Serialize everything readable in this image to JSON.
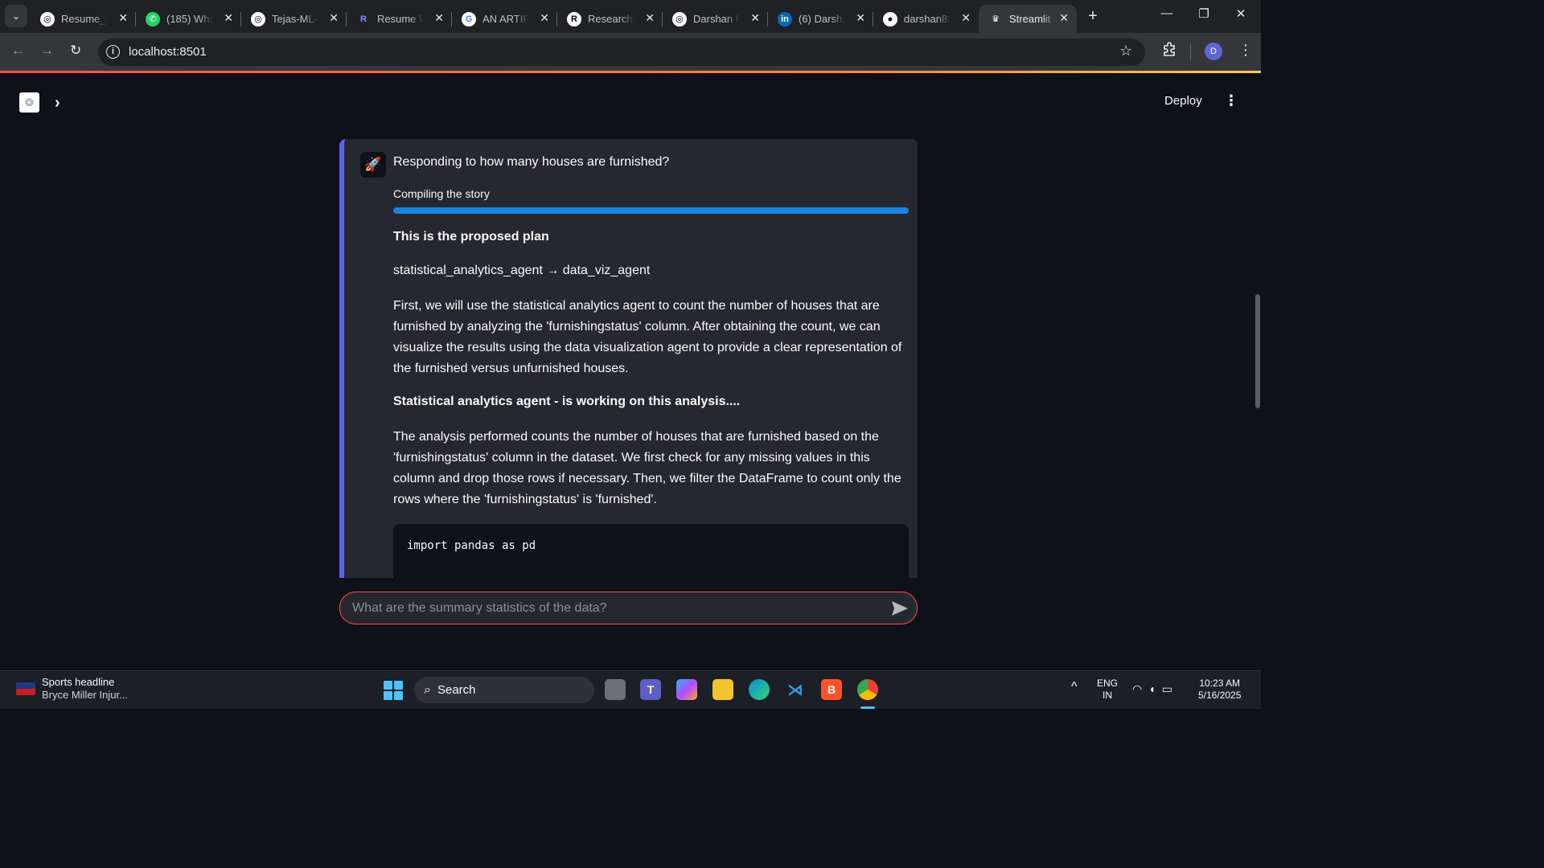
{
  "browser": {
    "tabs": [
      {
        "title": "Resume_N",
        "favicon": "openai-icon",
        "fav_char": "◎",
        "fav_bg": "#ffffff",
        "fav_fg": "#000000"
      },
      {
        "title": "(185) What",
        "favicon": "whatsapp-icon",
        "fav_char": "✆",
        "fav_bg": "#25d366",
        "fav_fg": "#ffffff"
      },
      {
        "title": "Tejas-ML-3",
        "favicon": "openai-icon",
        "fav_char": "◎",
        "fav_bg": "#ffffff",
        "fav_fg": "#000000"
      },
      {
        "title": "Resume W",
        "favicon": "resume-worded-icon",
        "fav_char": "R",
        "fav_bg": "#202124",
        "fav_fg": "#7b8cff"
      },
      {
        "title": "AN ARTIFIC",
        "favicon": "google-icon",
        "fav_char": "G",
        "fav_bg": "#ffffff",
        "fav_fg": "#4285f4"
      },
      {
        "title": "ResearchG",
        "favicon": "researchgate-icon",
        "fav_char": "R",
        "fav_bg": "#ffffff",
        "fav_fg": "#000000"
      },
      {
        "title": "Darshan M",
        "favicon": "openai-icon",
        "fav_char": "◎",
        "fav_bg": "#ffffff",
        "fav_fg": "#000000"
      },
      {
        "title": "(6) Darsha",
        "favicon": "linkedin-icon",
        "fav_char": "in",
        "fav_bg": "#0a66c2",
        "fav_fg": "#ffffff"
      },
      {
        "title": "darshan88",
        "favicon": "github-icon",
        "fav_char": "●",
        "fav_bg": "#ffffff",
        "fav_fg": "#000000"
      },
      {
        "title": "Streamlit",
        "favicon": "streamlit-icon",
        "fav_char": "♛",
        "fav_bg": "#35363a",
        "fav_fg": "#ffffff",
        "active": true
      }
    ],
    "url": "localhost:8501",
    "profile_initial": "D"
  },
  "app": {
    "header": {
      "deploy_label": "Deploy"
    },
    "message": {
      "responding_text": "Responding to how many houses are furnished?",
      "progress_label": "Compiling the story",
      "progress_fraction": 1.0,
      "plan_heading": "This is the proposed plan",
      "plan_steps": "statistical_analytics_agent → data_viz_agent",
      "plan_description": "First, we will use the statistical analytics agent to count the number of houses that are furnished by analyzing the 'furnishingstatus' column. After obtaining the count, we can visualize the results using the data visualization agent to provide a clear representation of the furnished versus unfurnished houses.",
      "agent_heading": "Statistical analytics agent - is working on this analysis....",
      "analysis_description": "The analysis performed counts the number of houses that are furnished based on the 'furnishingstatus' column in the dataset. We first check for any missing values in this column and drop those rows if necessary. Then, we filter the DataFrame to count only the rows where the 'furnishingstatus' is 'furnished'.",
      "code_first_line": "import pandas as pd"
    },
    "chat_input": {
      "placeholder": "What are the summary statistics of the data?"
    }
  },
  "taskbar": {
    "news_title": "Sports headline",
    "news_subtitle": "Bryce Miller Injur...",
    "search_label": "Search",
    "lang_line1": "ENG",
    "lang_line2": "IN",
    "time": "10:23 AM",
    "date": "5/16/2025"
  },
  "colors": {
    "accent_blue": "#1c83e1",
    "card_border": "#5d5fef",
    "input_border": "#ff4b4b",
    "background": "#0e1117",
    "card_bg": "#262730"
  }
}
